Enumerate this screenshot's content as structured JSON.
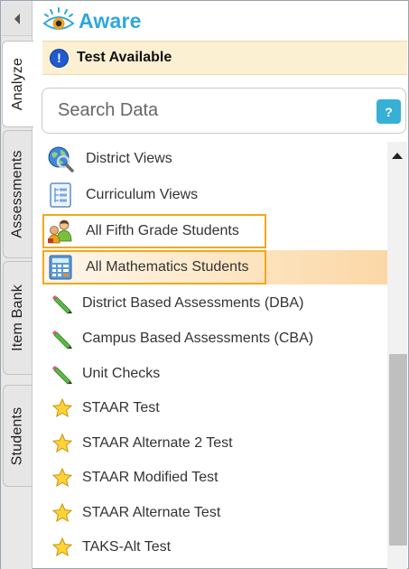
{
  "app": {
    "logo_text": "Aware",
    "brand_color": "#2fa7dc"
  },
  "tabs": [
    {
      "label": "Analyze",
      "active": true
    },
    {
      "label": "Assessments",
      "active": false
    },
    {
      "label": "Item Bank",
      "active": false
    },
    {
      "label": "Students",
      "active": false
    }
  ],
  "notice": {
    "icon": "info-icon",
    "text": "Test Available"
  },
  "search": {
    "placeholder": "Search Data",
    "help_label": "?"
  },
  "items": [
    {
      "label": "District Views",
      "icon": "district-globe-icon",
      "state": "normal"
    },
    {
      "label": "Curriculum Views",
      "icon": "curriculum-tree-icon",
      "state": "normal"
    },
    {
      "label": "All Fifth Grade Students",
      "icon": "students-group-icon",
      "state": "boxed"
    },
    {
      "label": "All Mathematics Students",
      "icon": "calculator-icon",
      "state": "selected"
    },
    {
      "label": "District Based Assessments (DBA)",
      "icon": "pencil-icon",
      "state": "normal"
    },
    {
      "label": "Campus Based Assessments (CBA)",
      "icon": "pencil-icon",
      "state": "normal"
    },
    {
      "label": "Unit Checks",
      "icon": "pencil-icon",
      "state": "normal"
    },
    {
      "label": "STAAR Test",
      "icon": "star-icon",
      "state": "normal"
    },
    {
      "label": "STAAR Alternate 2 Test",
      "icon": "star-icon",
      "state": "normal"
    },
    {
      "label": "STAAR Modified Test",
      "icon": "star-icon",
      "state": "normal"
    },
    {
      "label": "STAAR Alternate Test",
      "icon": "star-icon",
      "state": "normal"
    },
    {
      "label": "TAKS-Alt Test",
      "icon": "star-icon",
      "state": "normal"
    }
  ],
  "colors": {
    "highlight_border": "#f0a91c",
    "selected_bg": "#fde4bf",
    "notice_bg": "#fcf0d2"
  }
}
